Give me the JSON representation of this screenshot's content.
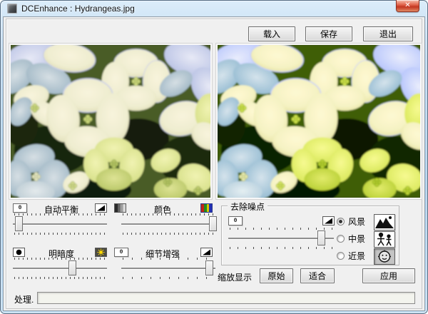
{
  "window": {
    "title": "DCEnhance : Hydrangeas.jpg",
    "close_glyph": "✕"
  },
  "toolbar": {
    "load": "载入",
    "save": "保存",
    "exit": "退出"
  },
  "adjustments": {
    "auto_balance": {
      "label": "自动平衡",
      "reset_label": "0",
      "value_pct": 6
    },
    "color": {
      "label": "颜色",
      "value_pct": 97
    },
    "brightness": {
      "label": "明暗度",
      "value_pct": 63
    },
    "detail_enhance": {
      "label": "细节增强",
      "reset_label": "0",
      "value_pct": 93
    }
  },
  "denoise": {
    "title": "去除噪点",
    "reset_label": "0",
    "value_pct": 88,
    "options": [
      {
        "label": "风景",
        "selected": true
      },
      {
        "label": "中景",
        "selected": false
      },
      {
        "label": "近景",
        "selected": false
      }
    ]
  },
  "zoom_display": {
    "label": "缩放显示",
    "original": "原始",
    "fit": "适合"
  },
  "apply_label": "应用",
  "status": {
    "label": "处理.",
    "progress_pct": 0
  },
  "colors": {
    "titlebar": "#bcd8ef",
    "dialog_bg": "#f0f0f0",
    "close_button": "#c33620",
    "accent_green": "#d7df8a"
  }
}
